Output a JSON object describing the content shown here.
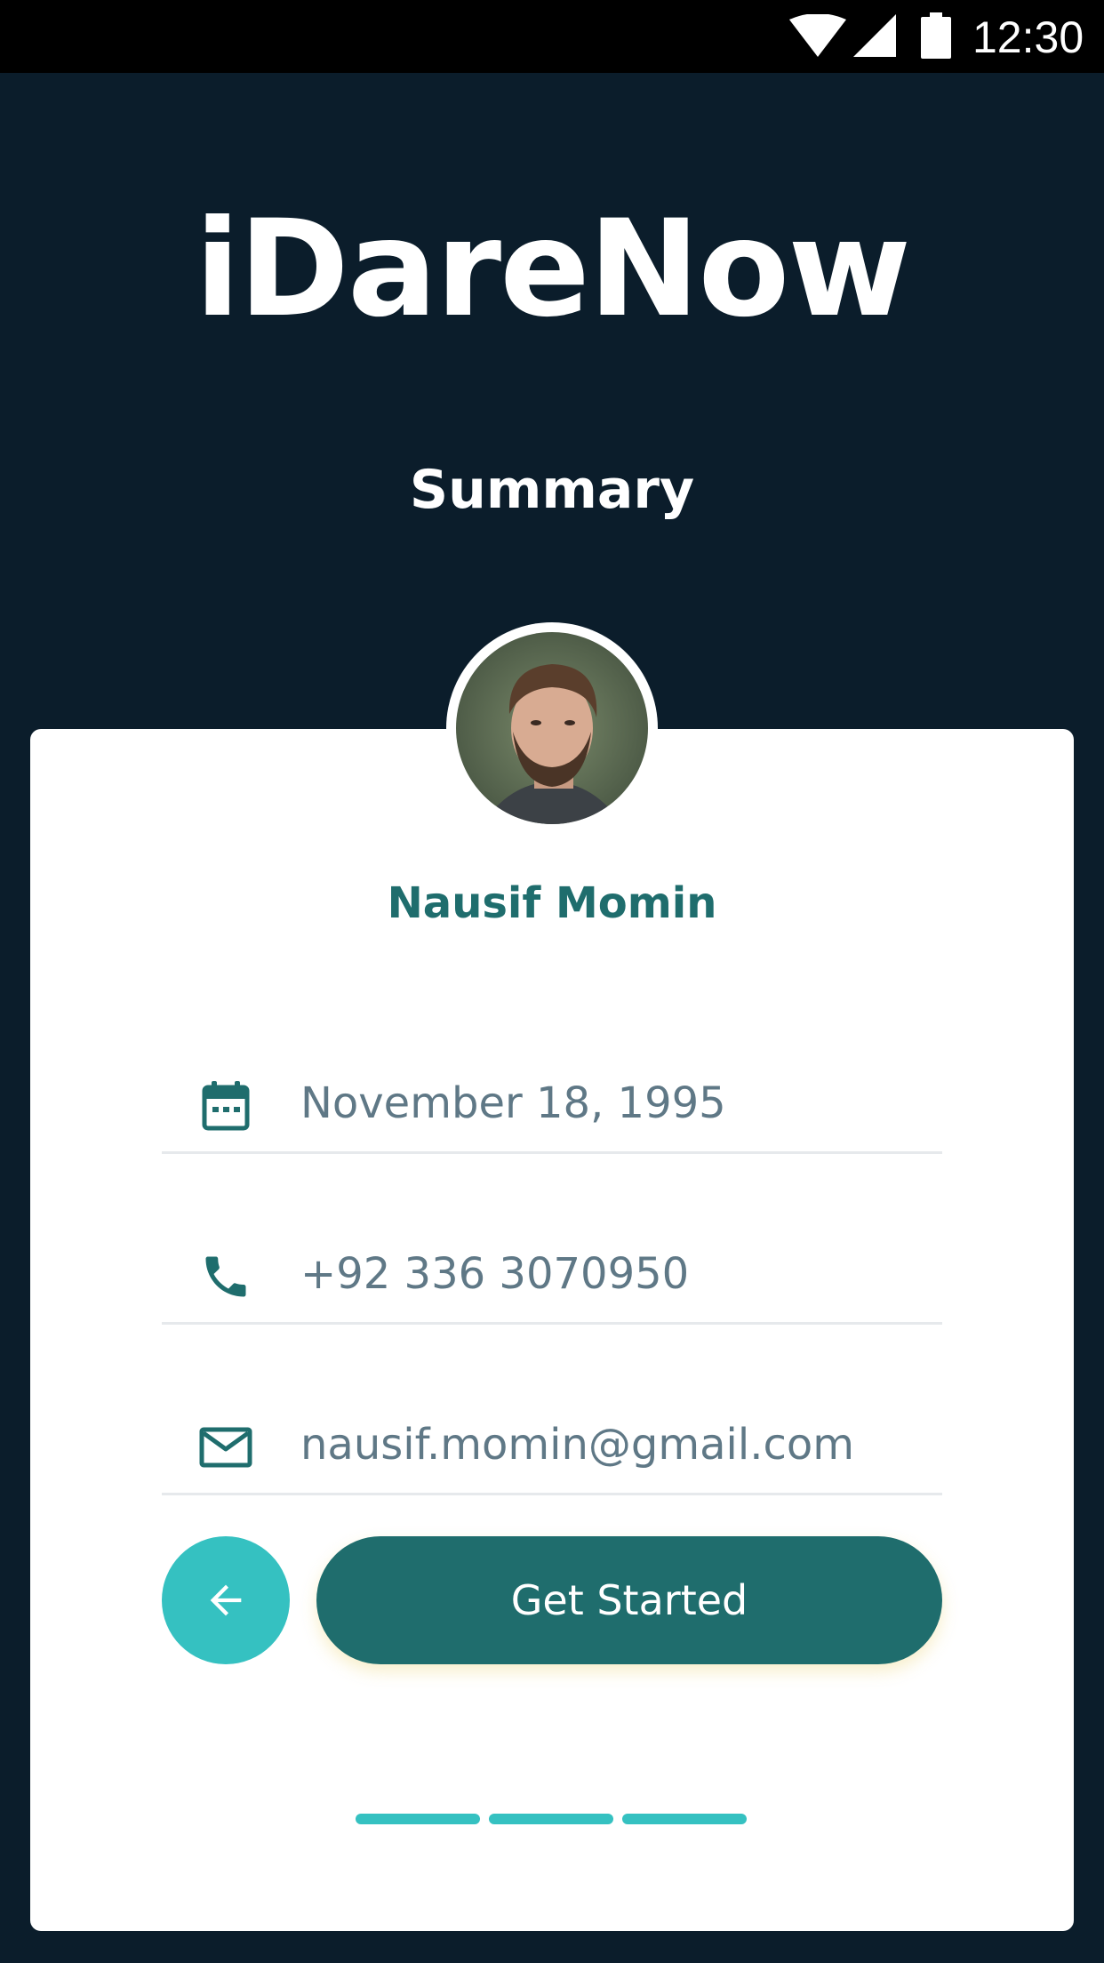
{
  "status_bar": {
    "time": "12:30",
    "icons": [
      "wifi-icon",
      "cell-signal-icon",
      "battery-icon"
    ]
  },
  "header": {
    "app_name": "iDareNow",
    "screen_title": "Summary"
  },
  "profile": {
    "name": "Nausif Momin",
    "date_of_birth": "November 18, 1995",
    "phone": "+92 336 3070950",
    "email": "nausif.momin@gmail.com"
  },
  "actions": {
    "back_icon": "arrow-left-icon",
    "primary_label": "Get Started"
  },
  "pagination": {
    "steps_total": 3,
    "active_steps": 3
  },
  "colors": {
    "background": "#0b1d2b",
    "card": "#ffffff",
    "primary": "#1f6d6d",
    "accent": "#35c1c1",
    "field_text": "#5f7886",
    "divider": "#e6e9ec"
  }
}
